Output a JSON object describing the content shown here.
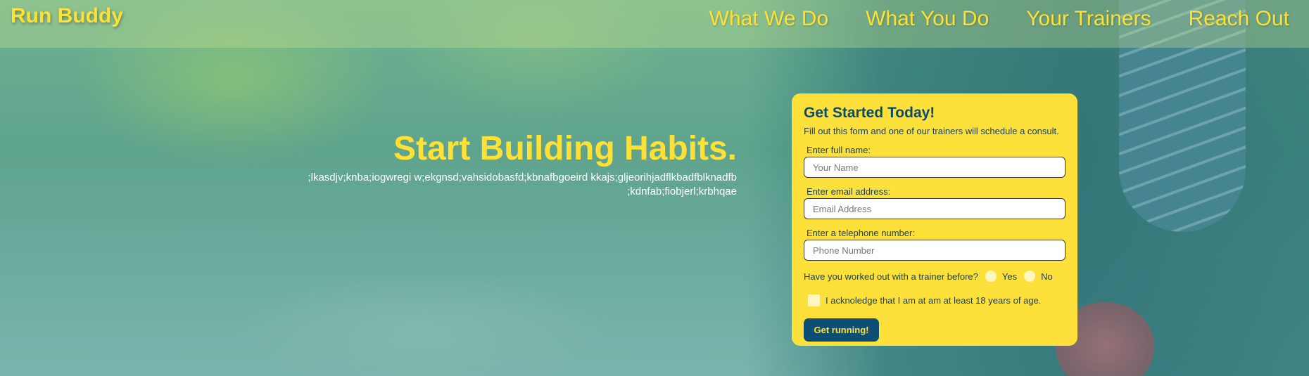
{
  "header": {
    "brand": "Run Buddy",
    "nav": [
      "What We Do",
      "What You Do",
      "Your Trainers",
      "Reach Out"
    ]
  },
  "hero": {
    "headline": "Start Building Habits.",
    "tagline": ";lkasdjv;knba;iogwregi w;ekgnsd;vahsidobasfd;kbnafbgoeird kkajs;gljeorihjadflkbadfblknadfb ;kdnfab;fiobjerl;krbhqae"
  },
  "form": {
    "title": "Get Started Today!",
    "subtitle": "Fill out this form and one of our trainers will schedule a consult.",
    "name_label": "Enter full name:",
    "name_placeholder": "Your Name",
    "email_label": "Enter email address:",
    "email_placeholder": "Email Address",
    "phone_label": "Enter a telephone number:",
    "phone_placeholder": "Phone Number",
    "trainer_question": "Have you worked out with a trainer before?",
    "yes_label": "Yes",
    "no_label": "No",
    "age_ack": "I acknoledge that I am at am at least 18 years of age.",
    "submit_label": "Get running!"
  },
  "colors": {
    "accent_yellow": "#ffe135",
    "card_yellow": "#fde13a",
    "button_blue": "#0d4f74"
  }
}
